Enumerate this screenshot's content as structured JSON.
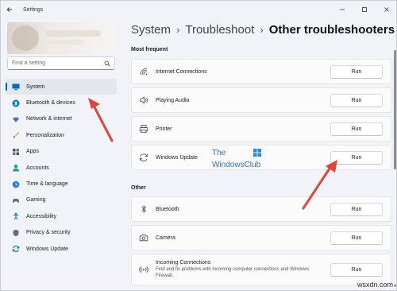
{
  "window": {
    "title": "Settings",
    "controls": [
      "minimize",
      "maximize",
      "close"
    ]
  },
  "sidebar": {
    "search_placeholder": "Find a setting",
    "items": [
      {
        "label": "System",
        "icon": "monitor-icon",
        "color": "#0067c0",
        "active": true
      },
      {
        "label": "Bluetooth & devices",
        "icon": "bluetooth-icon",
        "color": "#0078d4"
      },
      {
        "label": "Network & internet",
        "icon": "wifi-icon",
        "color": "#4a6fa5"
      },
      {
        "label": "Personalization",
        "icon": "brush-icon",
        "color": "#e3893a"
      },
      {
        "label": "Apps",
        "icon": "apps-icon",
        "color": "#555555"
      },
      {
        "label": "Accounts",
        "icon": "person-icon",
        "color": "#1aa37a"
      },
      {
        "label": "Time & language",
        "icon": "globe-clock-icon",
        "color": "#2b7bd8"
      },
      {
        "label": "Gaming",
        "icon": "gamepad-icon",
        "color": "#6b6b6b"
      },
      {
        "label": "Accessibility",
        "icon": "accessibility-icon",
        "color": "#1f5fbf"
      },
      {
        "label": "Privacy & security",
        "icon": "shield-icon",
        "color": "#6d6d6d"
      },
      {
        "label": "Windows Update",
        "icon": "update-icon",
        "color": "#0f6cbd"
      }
    ]
  },
  "breadcrumb": {
    "items": [
      "System",
      "Troubleshoot"
    ],
    "current": "Other troubleshooters"
  },
  "sections": {
    "most_frequent": {
      "title": "Most frequent",
      "items": [
        {
          "label": "Internet Connections",
          "icon": "network-signal-icon",
          "button": "Run"
        },
        {
          "label": "Playing Audio",
          "icon": "speaker-icon",
          "button": "Run"
        },
        {
          "label": "Printer",
          "icon": "printer-icon",
          "button": "Run"
        },
        {
          "label": "Windows Update",
          "icon": "refresh-icon",
          "button": "Run"
        }
      ]
    },
    "other": {
      "title": "Other",
      "items": [
        {
          "label": "Bluetooth",
          "icon": "bluetooth-icon",
          "button": "Run"
        },
        {
          "label": "Camera",
          "icon": "camera-icon",
          "button": "Run"
        },
        {
          "label": "Incoming Connections",
          "description": "Find and fix problems with incoming computer connections and Windows Firewall.",
          "icon": "antenna-icon",
          "button": "Run"
        }
      ]
    }
  },
  "watermark": {
    "line1": "The",
    "line2": "WindowsClub"
  },
  "site_mark": "wsxdn.com",
  "colors": {
    "accent": "#0067c0",
    "arrow": "#d9483b"
  }
}
